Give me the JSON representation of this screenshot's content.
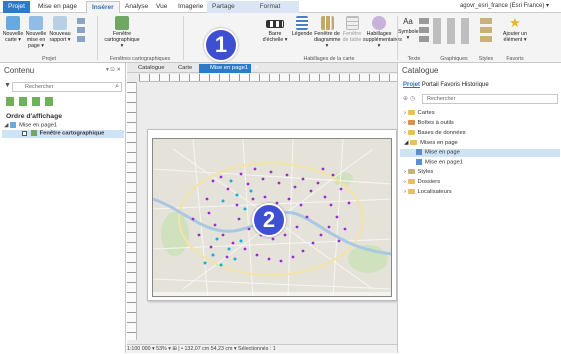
{
  "tabs": [
    "Projet",
    "Mise en page",
    "Insérer",
    "Analyse",
    "Vue",
    "Imagerie",
    "Partage",
    "Format"
  ],
  "user": "agovr_esri_france (Esri France) ▾",
  "ribbon": {
    "nouvelle_carte": "Nouvelle carte ▾",
    "nouvelle_mise_en_page": "Nouvelle mise en page ▾",
    "nouveau_rapport": "Nouveau rapport ▾",
    "fenetre_cartographique": "Fenêtre cartographique ▾",
    "barre_echelle": "Barre d'échelle ▾",
    "legende": "Légende",
    "fenetre_diagramme": "Fenêtre de diagramme ▾",
    "fenetre_table": "Fenêtre de table",
    "habillages_supp": "Habillages supplémentaires ▾",
    "symbole": "Symbole ▾",
    "ajouter_element": "Ajouter un élément ▾",
    "groups": [
      "Projet",
      "Fenêtres cartographiques",
      "Habillages de la carte",
      "Texte",
      "Graphiques",
      "Styles",
      "Favoris"
    ]
  },
  "left": {
    "title": "Contenu",
    "pin": "▾ ⊡ ✕",
    "search_placeholder": "Rechercher",
    "order_label": "Ordre d'affichage",
    "layout_item": "Mise en page1",
    "frame_item": "Fenêtre cartographique"
  },
  "center": {
    "view_tabs": [
      "Catalogue",
      "Carte",
      "Mise en page1"
    ],
    "status": "1:100 000  ▾   53% ▾      ⊞  |  •  132,07 cm 54,23 cm  ▾   Sélectionnés : 1"
  },
  "right": {
    "title": "Catalogue",
    "subtabs": [
      "Projet",
      "Portail",
      "Favoris",
      "Historique"
    ],
    "search_placeholder": "Rechercher",
    "items": [
      "Cartes",
      "Boîtes à outils",
      "Bases de données",
      "Mises en page",
      "Mise en page",
      "Mise en page1",
      "Styles",
      "Dossiers",
      "Localisateurs"
    ]
  },
  "badges": [
    "1",
    "2"
  ]
}
